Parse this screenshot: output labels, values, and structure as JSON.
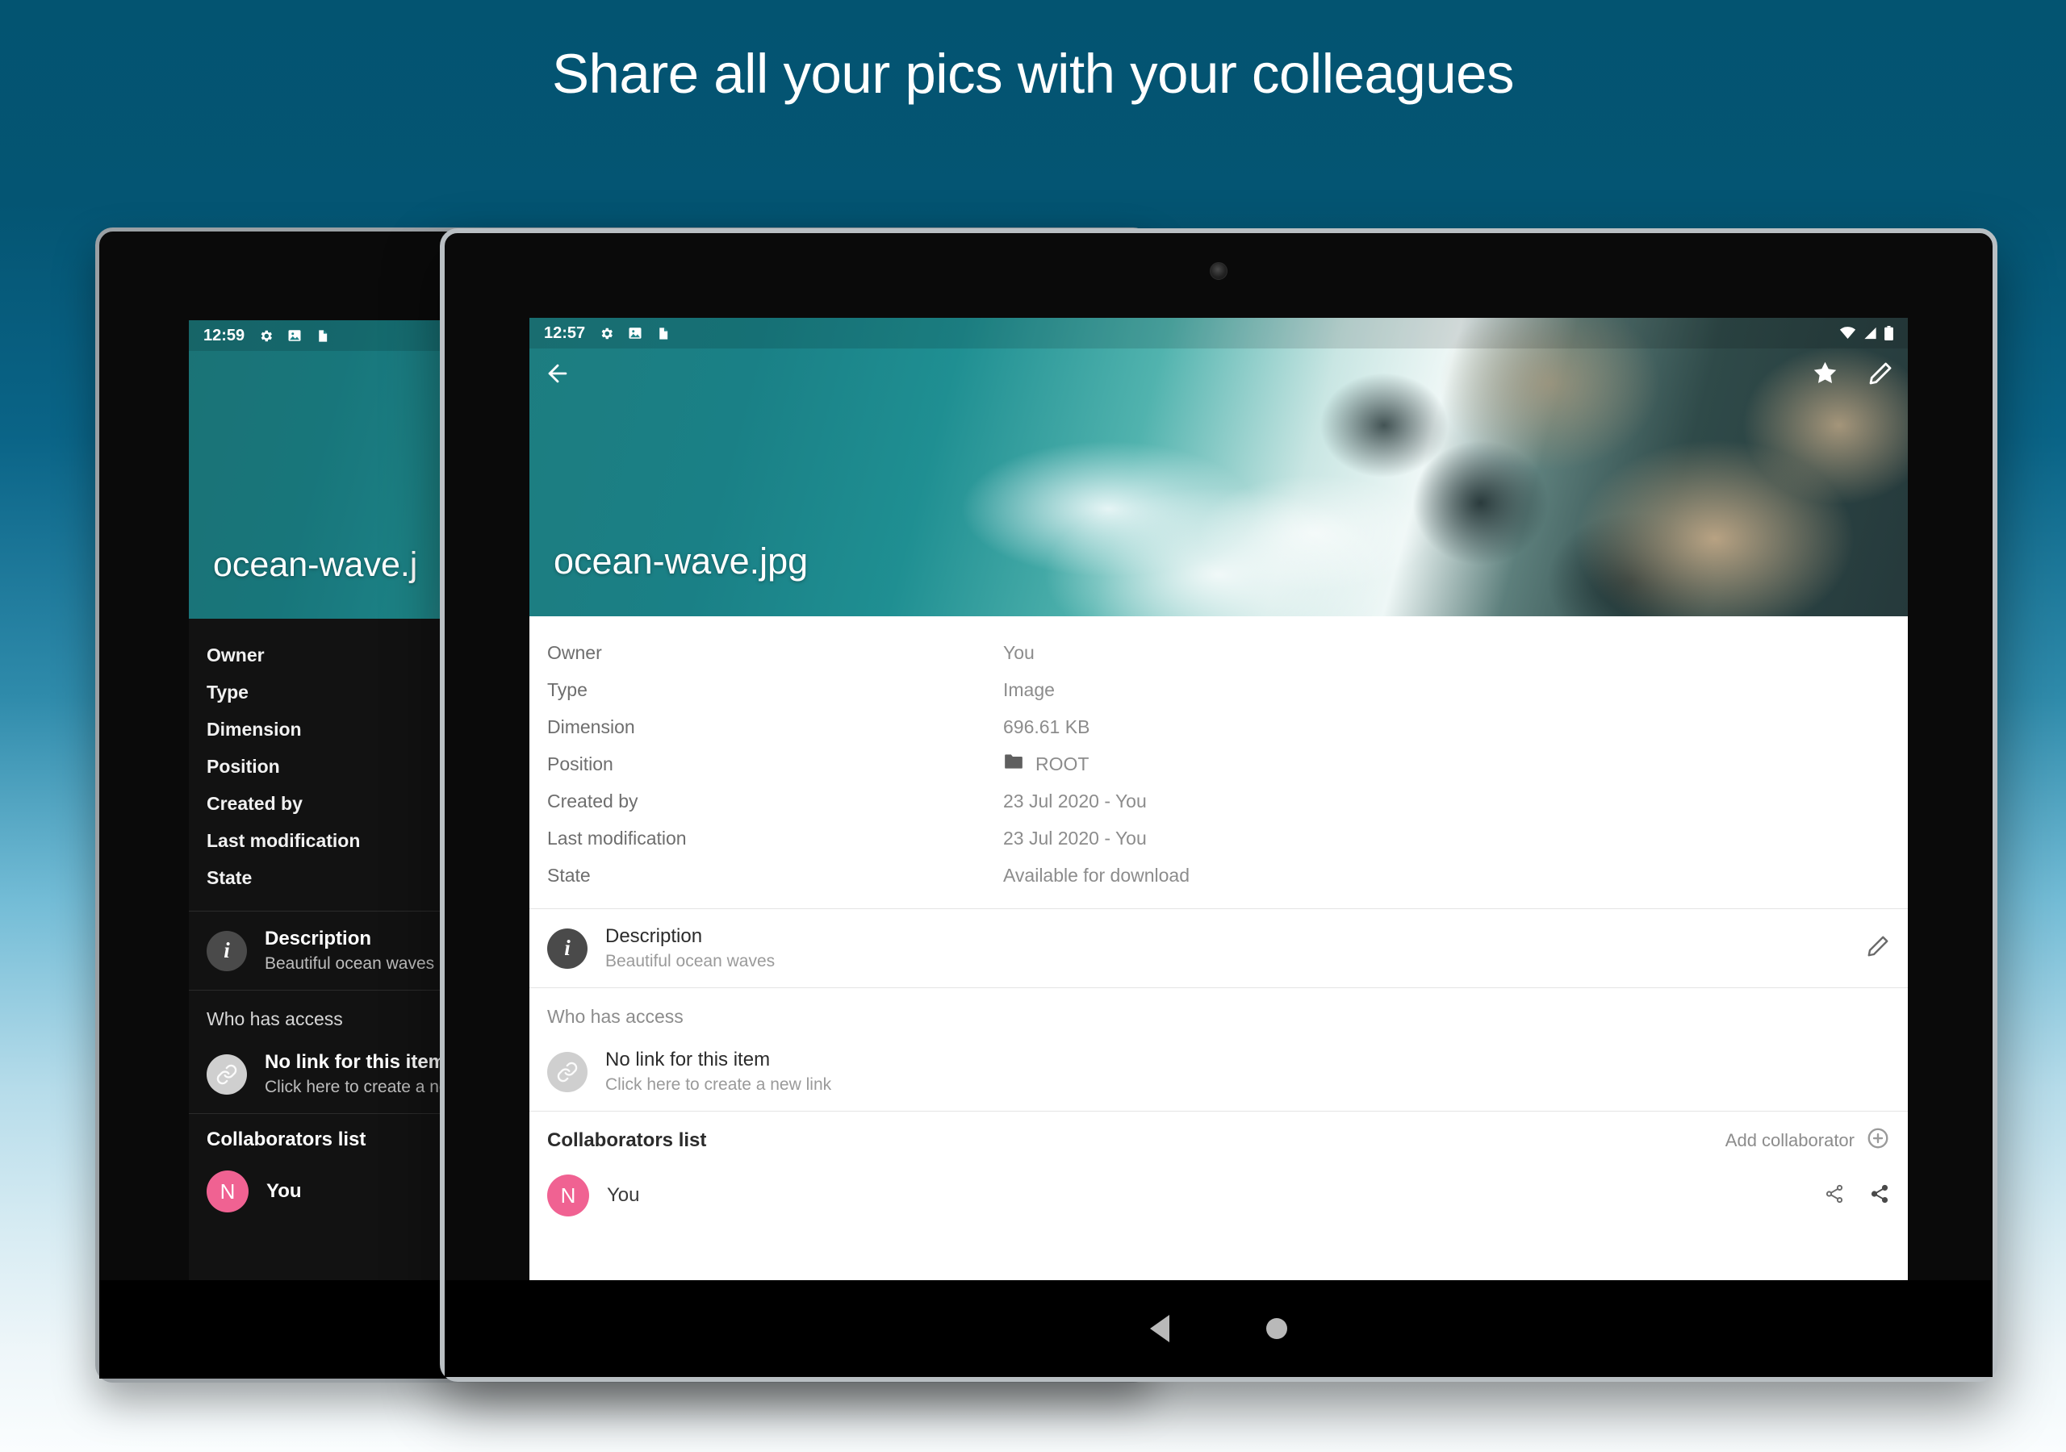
{
  "headline": "Share all your pics with your colleagues",
  "brand": {
    "accent": "#f06292",
    "bg_top": "#035471",
    "bg_bottom": "#fafdfe"
  },
  "front_device": {
    "status": {
      "time": "12:57",
      "icons": [
        "gear-icon",
        "image-icon",
        "document-icon",
        "wifi-icon",
        "signal-icon",
        "battery-icon"
      ]
    },
    "appbar": {
      "back": "back-arrow-icon",
      "favorite": "star-icon",
      "edit": "pencil-icon"
    },
    "file_title": "ocean-wave.jpg",
    "meta": [
      {
        "label": "Owner",
        "value": "You"
      },
      {
        "label": "Type",
        "value": "Image"
      },
      {
        "label": "Dimension",
        "value": "696.61 KB"
      },
      {
        "label": "Position",
        "value": "ROOT",
        "icon": "folder-icon"
      },
      {
        "label": "Created by",
        "value": "23 Jul 2020 - You"
      },
      {
        "label": "Last modification",
        "value": "23 Jul 2020 - You"
      },
      {
        "label": "State",
        "value": "Available for download"
      }
    ],
    "description": {
      "title": "Description",
      "text": "Beautiful ocean waves",
      "edit_icon": "pencil-icon"
    },
    "access": {
      "header": "Who has access",
      "link_title": "No link for this item",
      "link_sub": "Click here to create a new link"
    },
    "collaborators": {
      "title": "Collaborators list",
      "add_label": "Add collaborator",
      "rows": [
        {
          "initial": "N",
          "name": "You"
        }
      ]
    },
    "nav": {
      "back": "nav-back-icon",
      "home": "nav-home-icon"
    }
  },
  "back_device": {
    "status": {
      "time": "12:59"
    },
    "file_title": "ocean-wave.j",
    "meta": [
      {
        "label": "Owner"
      },
      {
        "label": "Type"
      },
      {
        "label": "Dimension"
      },
      {
        "label": "Position"
      },
      {
        "label": "Created by"
      },
      {
        "label": "Last modification"
      },
      {
        "label": "State"
      }
    ],
    "description": {
      "title": "Description",
      "text": "Beautiful ocean waves"
    },
    "access": {
      "header": "Who has access",
      "link_title": "No link for this item",
      "link_sub": "Click here to create a nev"
    },
    "collaborators": {
      "title": "Collaborators list",
      "rows": [
        {
          "initial": "N",
          "name": "You"
        }
      ]
    }
  }
}
